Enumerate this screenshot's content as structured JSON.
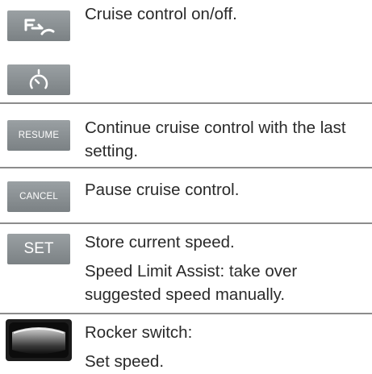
{
  "rows": [
    {
      "icon": "cruise-control-icon",
      "text": "Cruise control on/off."
    },
    {
      "icon": "speedometer-icon",
      "text": ""
    },
    {
      "button_label": "RESUME",
      "text": "Continue cruise control with the last setting."
    },
    {
      "button_label": "CANCEL",
      "text": "Pause cruise control."
    },
    {
      "button_label": "SET",
      "text": "Store current speed.",
      "text2": "Speed Limit Assist: take over suggested speed manually."
    },
    {
      "icon": "rocker-switch-icon",
      "text": "Rocker switch:",
      "text2": "Set speed."
    }
  ]
}
